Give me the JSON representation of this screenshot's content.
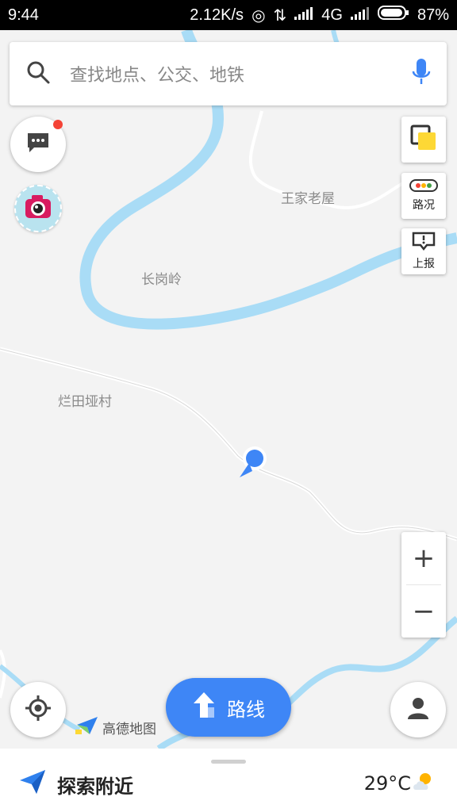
{
  "status_bar": {
    "time": "9:44",
    "network_speed": "2.12K/s",
    "network_type": "4G",
    "battery": "87%"
  },
  "search": {
    "placeholder": "查找地点、公交、地铁",
    "icon": "search-icon",
    "voice_icon": "microphone-icon"
  },
  "map": {
    "places": [
      "王家老屋",
      "长岗岭",
      "烂田垭村"
    ],
    "river_color": "#a9dcf6",
    "road_color": "#ffffff",
    "location_color": "#3e86f6"
  },
  "right_controls": {
    "layers_icon": "layers-icon",
    "traffic_label": "路况",
    "report_label": "上报",
    "zoom_in": "+",
    "zoom_out": "−"
  },
  "left_controls": {
    "message_icon": "message-icon",
    "camera_icon": "camera-icon",
    "locate_icon": "locate-icon"
  },
  "route_button": {
    "label": "路线"
  },
  "logo_text": "高德地图",
  "bottom_panel": {
    "explore_label": "探索附近",
    "weather_temp": "29°C"
  }
}
